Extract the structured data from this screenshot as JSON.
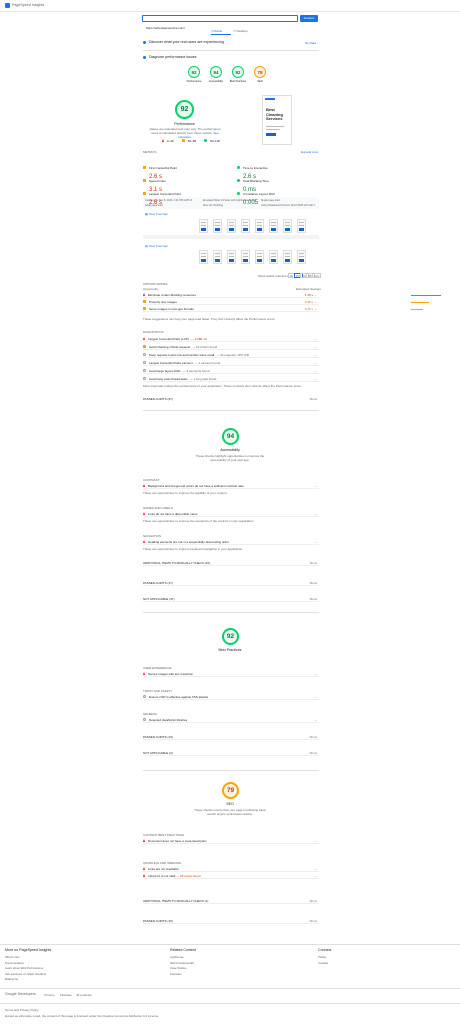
{
  "header": {
    "logo_text": "PageSpeed Insights"
  },
  "search": {
    "url": "https://ethecleanservice.com/",
    "button": "Analyze"
  },
  "tabs": [
    {
      "label": "Mobile"
    },
    {
      "label": "Desktop"
    }
  ],
  "banner": {
    "text": "Discover what your real users are experiencing",
    "link": "No Data"
  },
  "diagnose": {
    "title": "Diagnose performance issues"
  },
  "summary": [
    {
      "score": "92",
      "label": "Performance"
    },
    {
      "score": "94",
      "label": "Accessibility"
    },
    {
      "score": "92",
      "label": "Best Practices"
    },
    {
      "score": "79",
      "label": "SEO"
    }
  ],
  "performance": {
    "score": "92",
    "title": "Performance",
    "desc": "Values are estimated and may vary. The performance score is calculated directly from these metrics.",
    "desc_link": "See calculator.",
    "legend": [
      "0–49",
      "50–89",
      "90–100"
    ],
    "screenshot_title": "Best Cleaning Services"
  },
  "metrics": {
    "label": "METRICS",
    "expand": "Expand view",
    "items": [
      {
        "name": "First Contentful Paint",
        "value": "2.6 s",
        "color": "orange"
      },
      {
        "name": "Time to Interactive",
        "value": "2.6 s",
        "color": "green"
      },
      {
        "name": "Speed Index",
        "value": "3.1 s",
        "color": "orange"
      },
      {
        "name": "Total Blocking Time",
        "value": "0 ms",
        "color": "green"
      },
      {
        "name": "Largest Contentful Paint",
        "value": "2.6 s",
        "color": "orange"
      },
      {
        "name": "Cumulative Layout Shift",
        "value": "0.005",
        "color": "green"
      }
    ]
  },
  "runinfo": [
    "Captured at Dec 8, 2023, 2:41 PM GMT+5",
    "Emulated Moto G Power with Lighthouse 11.0.0",
    "Single page load",
    "Initial page load",
    "Slow 4G throttling",
    "Using HeadlessChromium 119.0.6045.123 with lr"
  ],
  "treemap": "View Treemap",
  "filmstrip_link": "View Treemap",
  "show_audits": {
    "label": "Show audits relevant to:",
    "chips": [
      "All",
      "FCP",
      "LCP",
      "TBT",
      "CLS"
    ]
  },
  "opportunities": {
    "label": "OPPORTUNITIES",
    "col1": "Opportunity",
    "col2": "Estimated Savings",
    "items": [
      {
        "name": "Eliminate render-blocking resources",
        "savings": "1.36 s"
      },
      {
        "name": "Properly size images",
        "savings": "0.45 s"
      },
      {
        "name": "Serve images in next-gen formats",
        "savings": "0.15 s"
      }
    ],
    "note": "These suggestions can help your page load faster. They don't directly affect the Performance score."
  },
  "diagnostics": {
    "label": "DIAGNOSTICS",
    "items": [
      {
        "name": "Largest Contentful Paint (LCP)",
        "extra": "— 2,580 ms",
        "kind": "tri"
      },
      {
        "name": "Avoid chaining critical requests",
        "extra": "— 16 chains found",
        "kind": "sq"
      },
      {
        "name": "Keep request counts low and transfer sizes small",
        "extra": "— 34 requests • 857 KiB",
        "kind": "circ"
      },
      {
        "name": "Largest Contentful Paint element",
        "extra": "— 1 element found",
        "kind": "circ"
      },
      {
        "name": "Avoid large layout shifts",
        "extra": "— 5 elements found",
        "kind": "circ"
      },
      {
        "name": "Avoid long main-thread tasks",
        "extra": "— 1 long task found",
        "kind": "circ"
      }
    ],
    "note": "More information about the performance of your application. These numbers don't directly affect the Performance score."
  },
  "passed_perf": "PASSED AUDITS (37)",
  "show": "Show",
  "accessibility": {
    "score": "94",
    "title": "Accessibility",
    "desc": "These checks highlight opportunities to improve the accessibility of your web app.",
    "contrast_label": "CONTRAST",
    "contrast_item": "Background and foreground colors do not have a sufficient contrast ratio.",
    "contrast_note": "These are opportunities to improve the legibility of your content.",
    "names_label": "NAMES AND LABELS",
    "names_item": "Links do not have a discernible name",
    "names_note": "These are opportunities to improve the semantics of the controls in your application.",
    "nav_label": "NAVIGATION",
    "nav_item": "Heading elements are not in a sequentially-descending order",
    "nav_note": "These are opportunities to improve keyboard navigation in your application.",
    "manual": "ADDITIONAL ITEMS TO MANUALLY CHECK (10)",
    "passed": "PASSED AUDITS (17)",
    "na": "NOT APPLICABLE (47)"
  },
  "best": {
    "score": "92",
    "title": "Best Practices",
    "trust_label": "USER EXPERIENCE",
    "trust_item": "Serves images with low resolution",
    "trust2_label": "TRUST AND SAFETY",
    "trust2_item": "Ensure CSP is effective against XSS attacks",
    "general_label": "GENERAL",
    "general_item": "Detected JavaScript libraries",
    "passed": "PASSED AUDITS (13)",
    "na": "NOT APPLICABLE (2)"
  },
  "seo": {
    "score": "79",
    "title": "SEO",
    "desc": "These checks ensure that your page is following basic search engine optimization advice.",
    "content_label": "CONTENT BEST PRACTICES",
    "content_item": "Document does not have a meta description",
    "crawl_label": "CRAWLING AND INDEXING",
    "crawl_item1": "Links are not crawlable",
    "crawl_item2": "robots.txt is not valid",
    "crawl_extra": "— 26 errors found",
    "manual": "ADDITIONAL ITEMS TO MANUALLY CHECK (1)",
    "passed": "PASSED AUDITS (10)"
  },
  "footer": {
    "col1_title": "More on PageSpeed Insights",
    "col1": [
      "What's new",
      "Documentation",
      "Learn about Web Performance",
      "Ask questions on Stack Overflow",
      "Mailing list"
    ],
    "col2_title": "Related Content",
    "col2": [
      "Lighthouse",
      "Web Fundamentals",
      "Case Studies",
      "Podcasts"
    ],
    "col3_title": "Connect",
    "col3": [
      "Twitter",
      "Youtube"
    ],
    "brand": "Google Developers",
    "links": [
      "Chrome",
      "Firebase",
      "All products"
    ],
    "terms": "Terms and Privacy Policy",
    "note": "Except as otherwise noted, the content of this page is licensed under the Creative Commons Attribution 4.0 License"
  },
  "colors": {
    "green": "#0cce6b",
    "orange": "#ffa400",
    "red": "#ff4e42",
    "blue": "#1a73e8"
  }
}
